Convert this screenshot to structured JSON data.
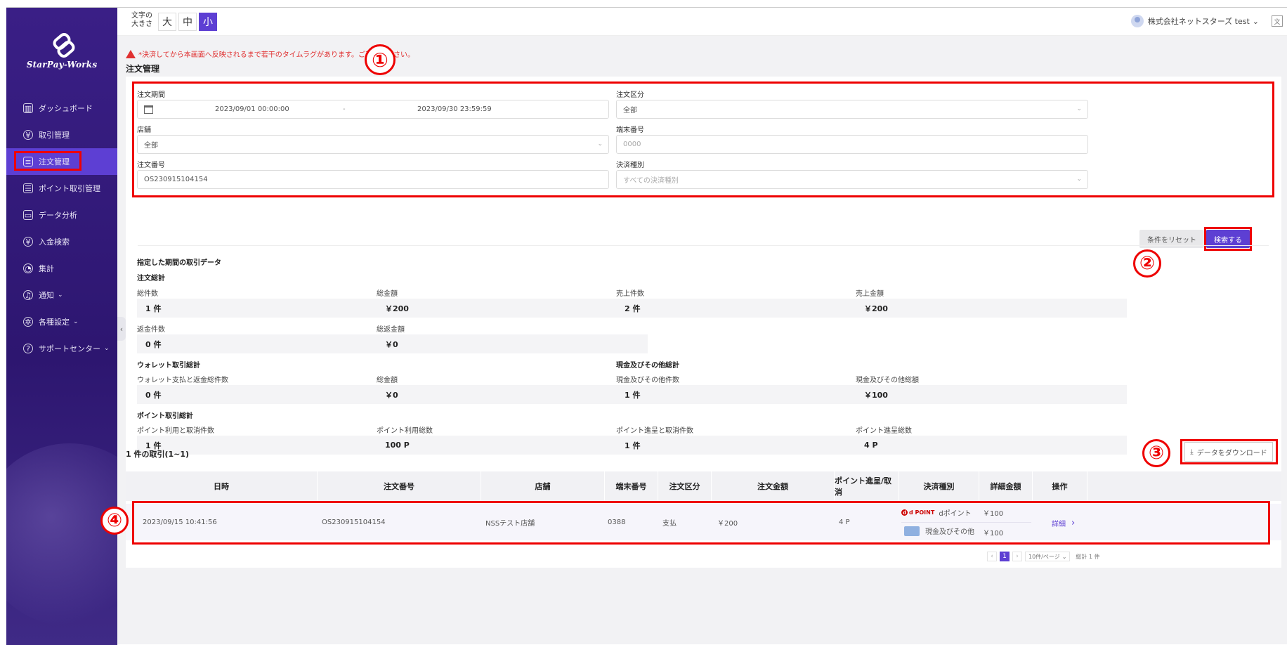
{
  "sidebar": {
    "logo_text": "StarPay-Works",
    "items": [
      {
        "label": "ダッシュボード",
        "icon": "chart-icon"
      },
      {
        "label": "取引管理",
        "icon": "money-bag-icon"
      },
      {
        "label": "注文管理",
        "icon": "clipboard-icon",
        "active": true
      },
      {
        "label": "ポイント取引管理",
        "icon": "database-icon"
      },
      {
        "label": "データ分析",
        "icon": "monitor-chart-icon"
      },
      {
        "label": "入金検索",
        "icon": "coin-icon"
      },
      {
        "label": "集計",
        "icon": "pie-chart-icon"
      },
      {
        "label": "通知",
        "icon": "bell-icon",
        "chevron": "⌄"
      },
      {
        "label": "各種設定",
        "icon": "settings-icon",
        "chevron": "⌄"
      },
      {
        "label": "サポートセンター",
        "icon": "help-icon",
        "chevron": "⌄"
      }
    ],
    "collapse_glyph": "‹"
  },
  "topbar": {
    "font_size_label": "文字の大きさ",
    "font_sizes": [
      "大",
      "中",
      "小"
    ],
    "selected_size": "小",
    "user_name": "株式会社ネットスターズ test",
    "user_chevron": "⌄",
    "lang_glyph": "文"
  },
  "notice": "*決済してから本画面へ反映されるまで若干のタイムラグがあります。ご了承ください。",
  "page_title": "注文管理",
  "annotations": [
    "①",
    "②",
    "③",
    "④"
  ],
  "filters": {
    "period_label": "注文期間",
    "period_start": "2023/09/01 00:00:00",
    "period_sep": "-",
    "period_end": "2023/09/30 23:59:59",
    "order_type_label": "注文区分",
    "order_type_value": "全部",
    "store_label": "店舗",
    "store_value": "全部",
    "terminal_label": "端末番号",
    "terminal_placeholder": "0000",
    "order_no_label": "注文番号",
    "order_no_value": "OS230915104154",
    "payment_type_label": "決済種別",
    "payment_type_placeholder": "すべての決済種別",
    "reset_button": "条件をリセット",
    "search_button": "検索する"
  },
  "summary": {
    "section_title": "指定した期間の取引データ",
    "order_total_title": "注文総計",
    "order_stats": [
      {
        "label": "総件数",
        "value": "1 件"
      },
      {
        "label": "総金額",
        "value": "￥200"
      },
      {
        "label": "売上件数",
        "value": "2 件"
      },
      {
        "label": "売上金額",
        "value": "￥200"
      },
      {
        "label": "返金件数",
        "value": "0 件"
      },
      {
        "label": "総返金額",
        "value": "￥0"
      }
    ],
    "wallet_title": "ウォレット取引総計",
    "wallet_stats": [
      {
        "label": "ウォレット支払と返金総件数",
        "value": "0 件"
      },
      {
        "label": "総金額",
        "value": "￥0"
      }
    ],
    "cash_title": "現金及びその他総計",
    "cash_stats": [
      {
        "label": "現金及びその他件数",
        "value": "1 件"
      },
      {
        "label": "現金及びその他総額",
        "value": "￥100"
      }
    ],
    "point_title": "ポイント取引総計",
    "point_stats": [
      {
        "label": "ポイント利用と取消件数",
        "value": "1 件"
      },
      {
        "label": "ポイント利用総数",
        "value": "100 P"
      },
      {
        "label": "ポイント進呈と取消件数",
        "value": "1 件"
      },
      {
        "label": "ポイント進呈総数",
        "value": "4 P"
      }
    ]
  },
  "results": {
    "title": "1 件の取引(1~1)",
    "download_button": "データをダウンロード",
    "download_icon": "⤓",
    "columns": [
      "日時",
      "注文番号",
      "店舗",
      "端末番号",
      "注文区分",
      "注文金額",
      "ポイント進呈/取消",
      "決済種別",
      "詳細金額",
      "操作"
    ],
    "rows": [
      {
        "datetime": "2023/09/15 10:41:56",
        "order_no": "OS230915104154",
        "store": "NSSテスト店舗",
        "terminal": "0388",
        "type": "支払",
        "amount": "￥200",
        "points": "4 P",
        "payments": [
          {
            "logo": "d POINT",
            "name": "dポイント",
            "amount": "￥100"
          },
          {
            "name": "現金及びその他",
            "amount": "￥100"
          }
        ],
        "action": "詳細",
        "action_glyph": "›"
      }
    ],
    "pager": {
      "prev": "‹",
      "page": "1",
      "next": "›",
      "page_size": "10件/ページ",
      "total": "総計 1 件"
    }
  }
}
